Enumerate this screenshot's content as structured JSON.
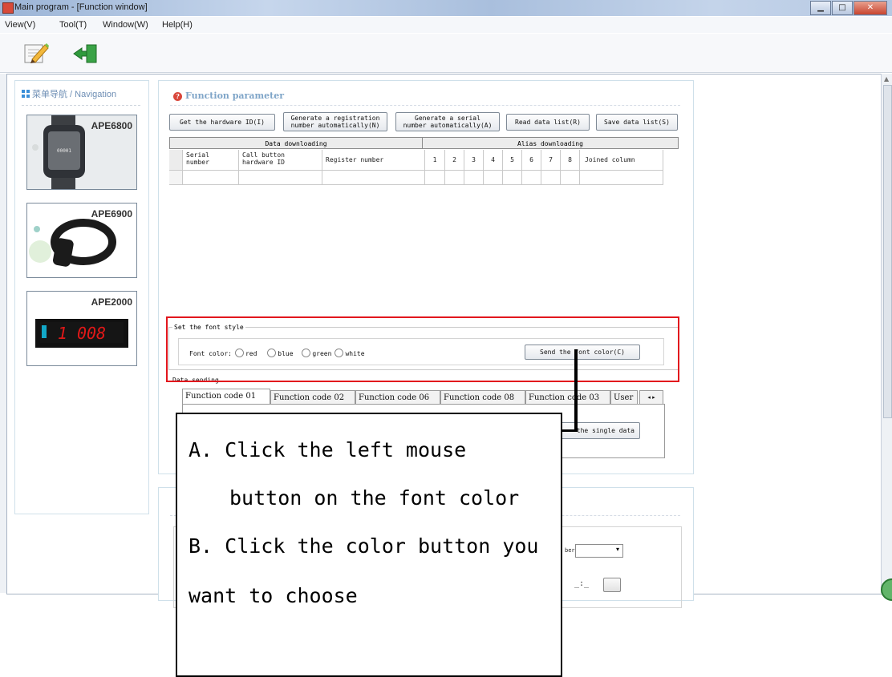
{
  "window": {
    "title": "Main program - [Function window]",
    "controls": [
      "minimize",
      "restore",
      "close"
    ]
  },
  "menu": [
    "View(V)",
    "Tool(T)",
    "Window(W)",
    "Help(H)"
  ],
  "toolbar": {
    "icons": [
      "edit-icon",
      "exit-icon"
    ]
  },
  "navigation": {
    "header": "菜单导航 / Navigation",
    "products": [
      {
        "name": "APE6800",
        "screen": "00001"
      },
      {
        "name": "APE6900"
      },
      {
        "name": "APE2000",
        "display": "1 008"
      }
    ]
  },
  "function_panel": {
    "title": "Function parameter",
    "buttons": {
      "get_hw": "Get the hardware ID(I)",
      "gen_reg": "Generate a registration\nnumber automatically(N)",
      "gen_serial": "Generate a serial\nnumber automatically(A)",
      "read_list": "Read data list(R)",
      "save_list": "Save data list(S)"
    },
    "groups": {
      "download": "Data downloading",
      "alias": "Alias downloading"
    },
    "columns": [
      "Serial\nnumber",
      "Call button\nhardware ID",
      "Register number",
      "1",
      "2",
      "3",
      "4",
      "5",
      "6",
      "7",
      "8",
      "Joined column"
    ],
    "font_style": {
      "legend": "Set the font style",
      "label": "Font color:",
      "options": [
        "red",
        "blue",
        "green",
        "white"
      ],
      "send_button": "Send the font color(C)"
    },
    "data_sending": {
      "legend": "Data sending",
      "tabs": [
        "Function code 01",
        "Function code 02",
        "Function code 06",
        "Function code 08",
        "Function code 03",
        "User"
      ],
      "single_button": "the single data"
    }
  },
  "lower_panel": {
    "select_label": "ber",
    "time_value": "_:_"
  },
  "callout": {
    "line1": "A. Click   the   left   mouse",
    "line2": "button on the font color",
    "line3": "B. Click the color button you",
    "line4": "want to choose"
  },
  "colors": {
    "highlight_box": "#e2161d",
    "nav_text": "#6f8fb5",
    "title_text": "#7fa5c8"
  }
}
